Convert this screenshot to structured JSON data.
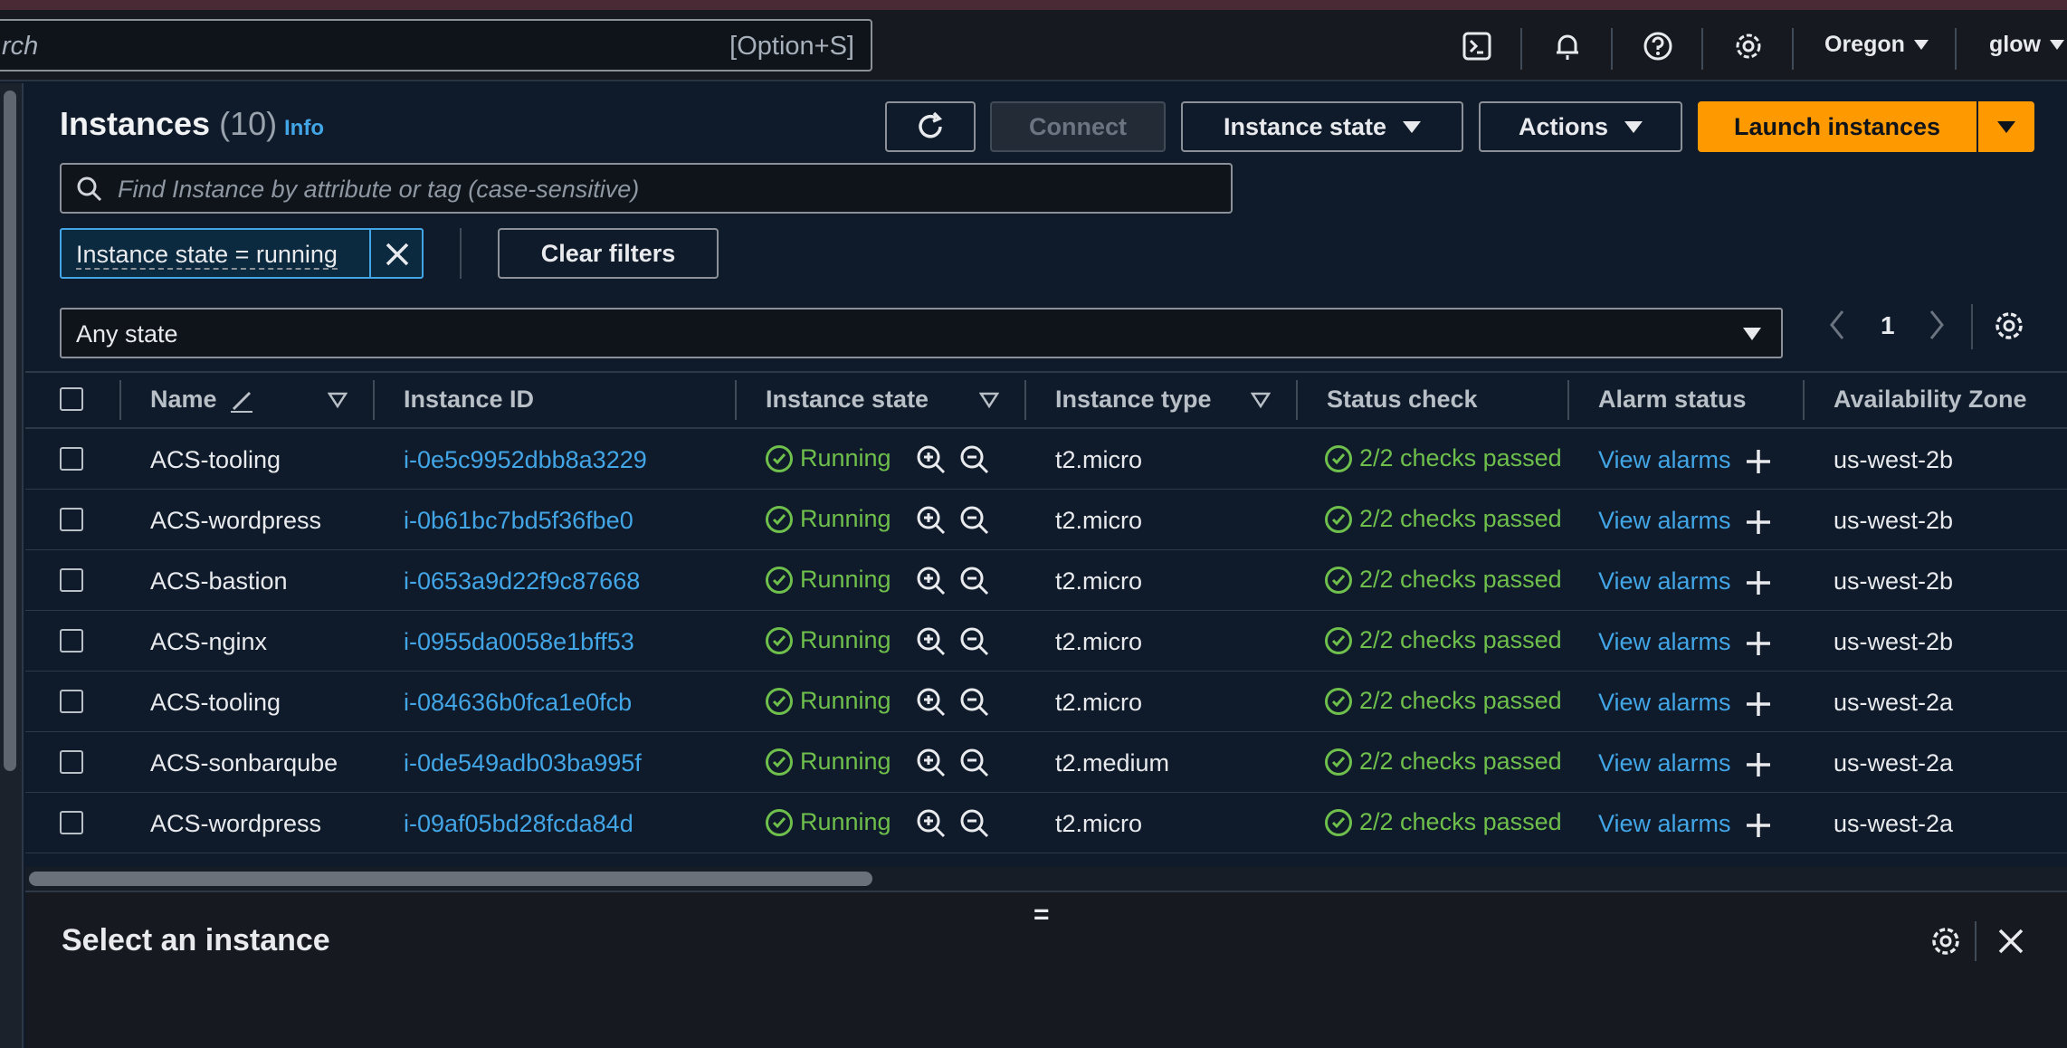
{
  "topbar": {
    "search_placeholder": "rch",
    "search_shortcut": "[Option+S]",
    "region": "Oregon",
    "user": "glow",
    "icons": [
      "cloudshell-icon",
      "bell-icon",
      "help-icon",
      "settings-icon"
    ]
  },
  "header": {
    "title": "Instances",
    "count": "(10)",
    "info": "Info",
    "buttons": {
      "refresh": "refresh-icon",
      "connect": "Connect",
      "instance_state": "Instance state",
      "actions": "Actions",
      "launch": "Launch instances"
    }
  },
  "filter": {
    "placeholder": "Find Instance by attribute or tag (case-sensitive)",
    "token": "Instance state = running",
    "clear": "Clear filters",
    "state_select": "Any state"
  },
  "pagination": {
    "page": "1"
  },
  "table": {
    "columns": [
      "Name",
      "Instance ID",
      "Instance state",
      "Instance type",
      "Status check",
      "Alarm status",
      "Availability Zone"
    ],
    "rows": [
      {
        "name": "ACS-tooling",
        "id": "i-0e5c9952dbb8a3229",
        "state": "Running",
        "type": "t2.micro",
        "status": "2/2 checks passed",
        "alarm": "View alarms",
        "az": "us-west-2b"
      },
      {
        "name": "ACS-wordpress",
        "id": "i-0b61bc7bd5f36fbe0",
        "state": "Running",
        "type": "t2.micro",
        "status": "2/2 checks passed",
        "alarm": "View alarms",
        "az": "us-west-2b"
      },
      {
        "name": "ACS-bastion",
        "id": "i-0653a9d22f9c87668",
        "state": "Running",
        "type": "t2.micro",
        "status": "2/2 checks passed",
        "alarm": "View alarms",
        "az": "us-west-2b"
      },
      {
        "name": "ACS-nginx",
        "id": "i-0955da0058e1bff53",
        "state": "Running",
        "type": "t2.micro",
        "status": "2/2 checks passed",
        "alarm": "View alarms",
        "az": "us-west-2b"
      },
      {
        "name": "ACS-tooling",
        "id": "i-084636b0fca1e0fcb",
        "state": "Running",
        "type": "t2.micro",
        "status": "2/2 checks passed",
        "alarm": "View alarms",
        "az": "us-west-2a"
      },
      {
        "name": "ACS-sonbarqube",
        "id": "i-0de549adb03ba995f",
        "state": "Running",
        "type": "t2.medium",
        "status": "2/2 checks passed",
        "alarm": "View alarms",
        "az": "us-west-2a"
      },
      {
        "name": "ACS-wordpress",
        "id": "i-09af05bd28fcda84d",
        "state": "Running",
        "type": "t2.micro",
        "status": "2/2 checks passed",
        "alarm": "View alarms",
        "az": "us-west-2a"
      }
    ]
  },
  "detail": {
    "title": "Select an instance",
    "handle": "="
  },
  "colors": {
    "accent": "#42a5e6",
    "launch": "#ff9900",
    "running": "#6fbf4c"
  }
}
